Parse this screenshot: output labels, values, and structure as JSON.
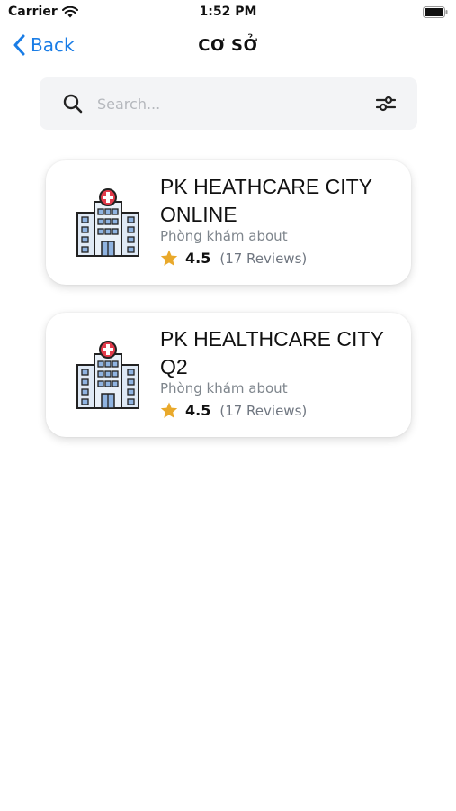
{
  "status_bar": {
    "carrier": "Carrier",
    "time": "1:52 PM"
  },
  "nav": {
    "back_label": "Back",
    "title": "CƠ SỞ"
  },
  "search": {
    "placeholder": "Search...",
    "value": ""
  },
  "clinics": [
    {
      "name": "PK HEATHCARE CITY ONLINE",
      "subtitle": "Phòng khám about",
      "rating": "4.5",
      "reviews": "(17 Reviews)",
      "icon": "hospital-icon"
    },
    {
      "name": "PK HEALTHCARE CITY Q2",
      "subtitle": "Phòng khám about",
      "rating": "4.5",
      "reviews": "(17 Reviews)",
      "icon": "hospital-icon"
    }
  ],
  "colors": {
    "accent": "#1a7de6",
    "star": "#e9a92b",
    "hospital_red": "#e23a4a",
    "card_bg": "#ffffff",
    "search_bg": "#f3f4f6"
  }
}
